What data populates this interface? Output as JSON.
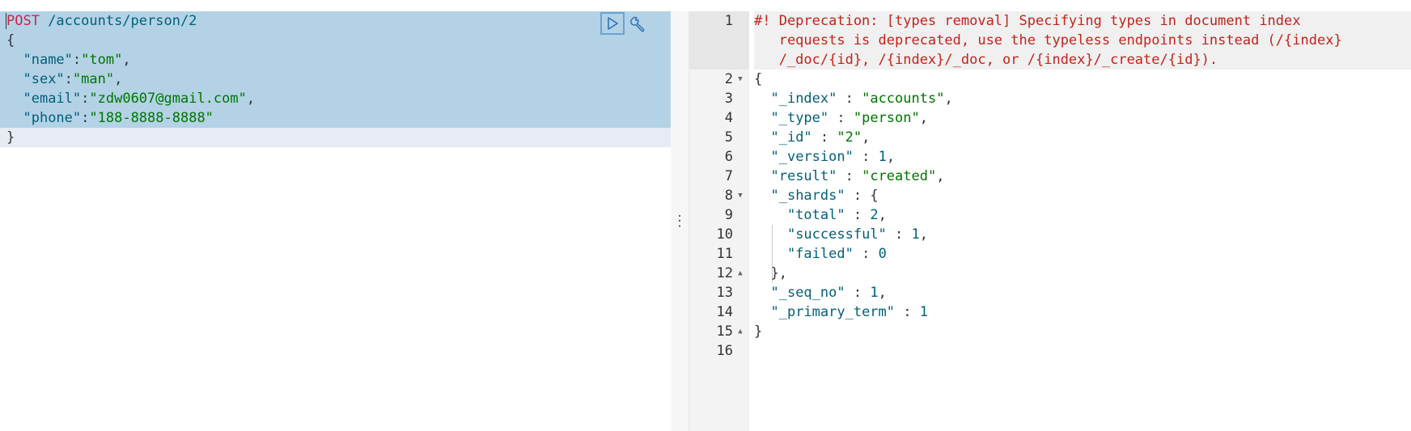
{
  "request": {
    "method": "POST",
    "url": " /accounts/person/2",
    "open_brace": "{",
    "fields": [
      {
        "key": "\"name\"",
        "value": "\"tom\"",
        "trail": ","
      },
      {
        "key": "\"sex\"",
        "value": "\"man\"",
        "trail": ","
      },
      {
        "key": "\"email\"",
        "value": "\"zdw0607@gmail.com\"",
        "trail": ","
      },
      {
        "key": "\"phone\"",
        "value": "\"188-8888-8888\"",
        "trail": ""
      }
    ],
    "close_brace": "}",
    "actions": {
      "run_icon": "play-icon",
      "settings_icon": "wrench-icon"
    }
  },
  "resizer": {
    "glyph": "⋮"
  },
  "response": {
    "line_numbers": [
      "1",
      "2",
      "3",
      "4",
      "5",
      "6",
      "7",
      "8",
      "9",
      "10",
      "11",
      "12",
      "13",
      "14",
      "15",
      "16"
    ],
    "warning_lines": [
      "#! Deprecation: [types removal] Specifying types in document index",
      "   requests is deprecated, use the typeless endpoints instead (/{index}",
      "   /_doc/{id}, /{index}/_doc, or /{index}/_create/{id})."
    ],
    "body": {
      "open": "{",
      "index_key": "\"_index\"",
      "index_val": "\"accounts\"",
      "type_key": "\"_type\"",
      "type_val": "\"person\"",
      "id_key": "\"_id\"",
      "id_val": "\"2\"",
      "version_key": "\"_version\"",
      "version_val": "1",
      "result_key": "\"result\"",
      "result_val": "\"created\"",
      "shards_key": "\"_shards\"",
      "total_key": "\"total\"",
      "total_val": "2",
      "successful_key": "\"successful\"",
      "successful_val": "1",
      "failed_key": "\"failed\"",
      "failed_val": "0",
      "shards_close": "},",
      "seq_key": "\"_seq_no\"",
      "seq_val": "1",
      "term_key": "\"_primary_term\"",
      "term_val": "1",
      "close": "}"
    }
  },
  "colors": {
    "selection": "#b3d2e6",
    "method": "#c7254e",
    "key": "#00607a",
    "string": "#007400",
    "warning": "#c4231a"
  }
}
